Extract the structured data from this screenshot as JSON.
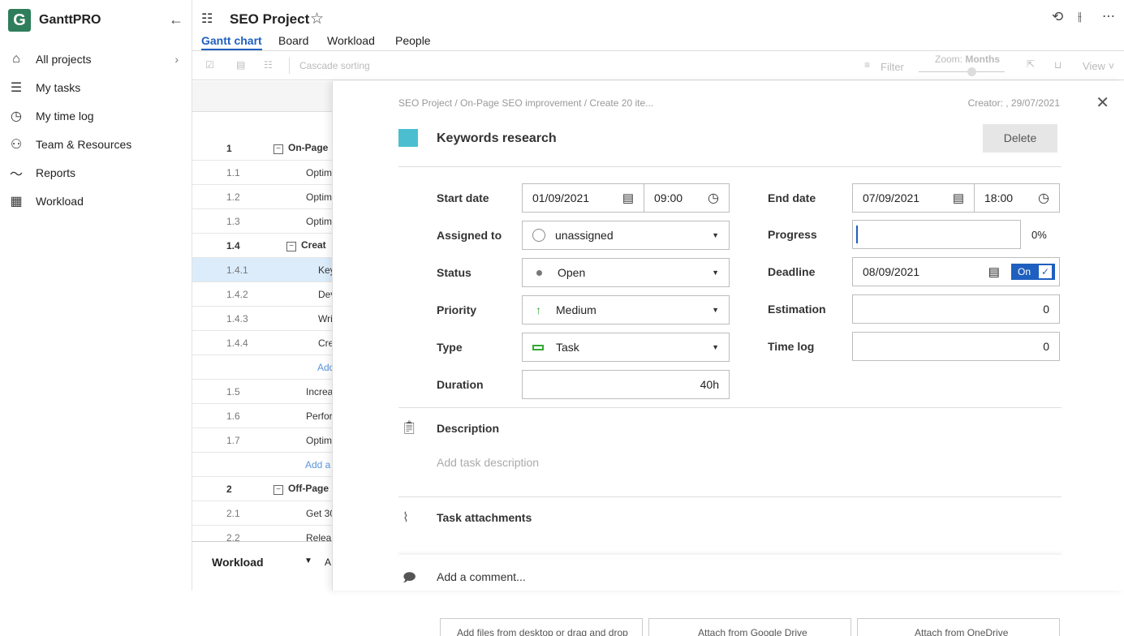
{
  "app": {
    "logo_letter": "G",
    "name": "GanttPRO"
  },
  "sidebar": {
    "items": [
      {
        "label": "All projects",
        "icon": "home-icon"
      },
      {
        "label": "My tasks",
        "icon": "list-icon"
      },
      {
        "label": "My time log",
        "icon": "clock-icon"
      },
      {
        "label": "Team & Resources",
        "icon": "team-icon"
      },
      {
        "label": "Reports",
        "icon": "chart-line-icon"
      },
      {
        "label": "Workload",
        "icon": "grid-icon"
      }
    ]
  },
  "header": {
    "title": "SEO Project",
    "tabs": [
      "Gantt chart",
      "Board",
      "Workload",
      "People"
    ],
    "active_tab": "Gantt chart"
  },
  "toolbar": {
    "cascade": "Cascade sorting",
    "filter": "Filter",
    "zoom_label": "Zoom:",
    "zoom_value": "Months",
    "view": "View"
  },
  "grid": {
    "rows": [
      {
        "num": "1",
        "name": "On-Page",
        "bold": true,
        "group": true
      },
      {
        "num": "1.1",
        "name": "Optim"
      },
      {
        "num": "1.2",
        "name": "Optim"
      },
      {
        "num": "1.3",
        "name": "Optim"
      },
      {
        "num": "1.4",
        "name": "Creat",
        "bold": true,
        "group": true
      },
      {
        "num": "1.4.1",
        "name": "Key",
        "selected": true
      },
      {
        "num": "1.4.2",
        "name": "Dev"
      },
      {
        "num": "1.4.3",
        "name": "Wri"
      },
      {
        "num": "1.4.4",
        "name": "Cre"
      },
      {
        "num": "",
        "add": "Add"
      },
      {
        "num": "1.5",
        "name": "Increa"
      },
      {
        "num": "1.6",
        "name": "Perfor"
      },
      {
        "num": "1.7",
        "name": "Optim"
      },
      {
        "num": "",
        "add": "Add a"
      },
      {
        "num": "2",
        "name": "Off-Page",
        "bold": true,
        "group": true
      },
      {
        "num": "2.1",
        "name": "Get 30"
      },
      {
        "num": "2.2",
        "name": "Relea"
      }
    ],
    "footer": {
      "label": "Workload",
      "extra": "A"
    }
  },
  "task": {
    "breadcrumb": "SEO Project / On-Page SEO improvement / Create 20 ite...",
    "creator": "Creator: , 29/07/2021",
    "color": "#4bbfcf",
    "name": "Keywords research",
    "delete": "Delete",
    "start_date_label": "Start date",
    "start_date": "01/09/2021",
    "start_time": "09:00",
    "end_date_label": "End date",
    "end_date": "07/09/2021",
    "end_time": "18:00",
    "assigned_label": "Assigned to",
    "assigned": "unassigned",
    "progress_label": "Progress",
    "progress": "0%",
    "status_label": "Status",
    "status": "Open",
    "deadline_label": "Deadline",
    "deadline": "08/09/2021",
    "deadline_toggle": "On",
    "priority_label": "Priority",
    "priority": "Medium",
    "estimation_label": "Estimation",
    "estimation": "0",
    "type_label": "Type",
    "type": "Task",
    "timelog_label": "Time log",
    "timelog": "0",
    "duration_label": "Duration",
    "duration": "40h",
    "description_label": "Description",
    "description_placeholder": "Add task description",
    "attachments_label": "Task attachments",
    "attach_buttons": [
      "Add files from desktop or drag and drop",
      "Attach from Google Drive",
      "Attach from OneDrive"
    ],
    "comment_placeholder": "Add a comment..."
  }
}
